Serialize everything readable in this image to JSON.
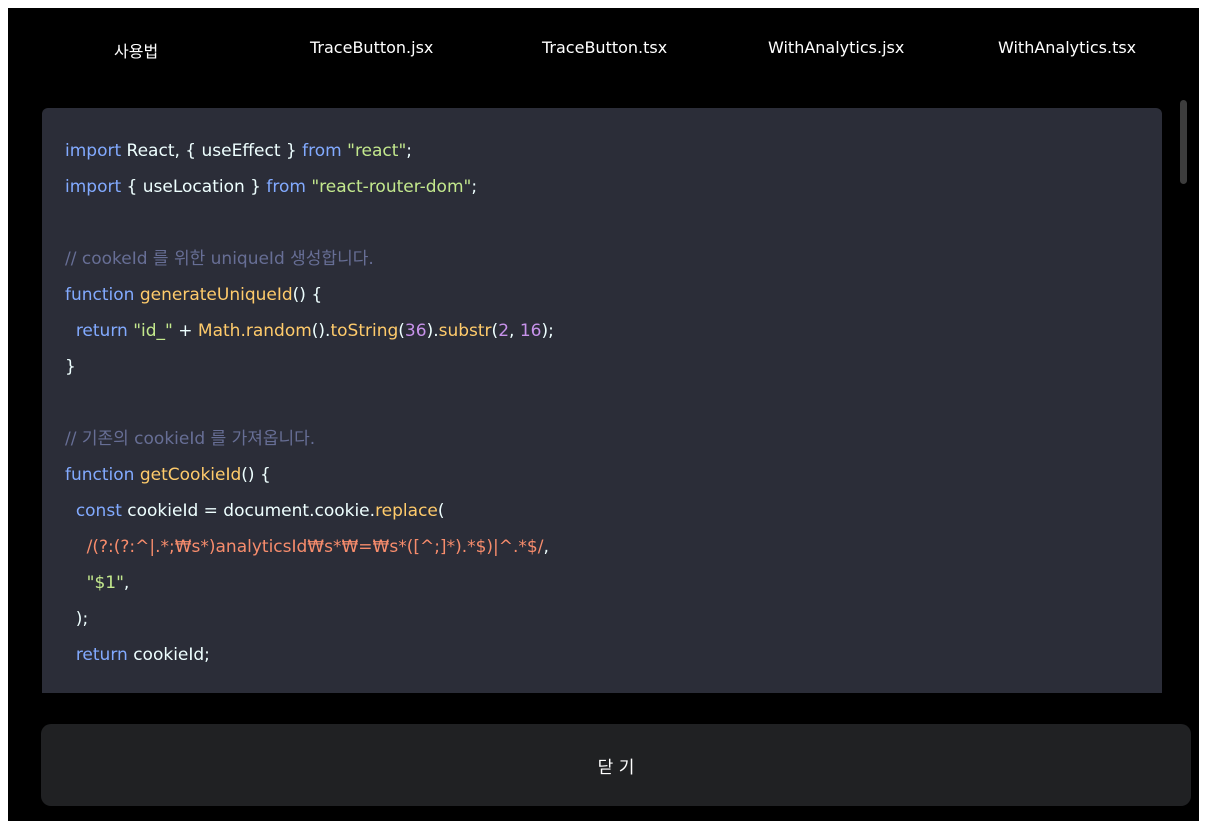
{
  "tabs": [
    {
      "label": "사용법"
    },
    {
      "label": "TraceButton.jsx"
    },
    {
      "label": "TraceButton.tsx"
    },
    {
      "label": "WithAnalytics.jsx"
    },
    {
      "label": "WithAnalytics.tsx"
    }
  ],
  "code": {
    "lines": [
      [
        {
          "t": "import",
          "c": "keyword"
        },
        {
          "t": " React, { useEffect } ",
          "c": "plain"
        },
        {
          "t": "from",
          "c": "keyword"
        },
        {
          "t": " ",
          "c": "plain"
        },
        {
          "t": "\"react\"",
          "c": "string"
        },
        {
          "t": ";",
          "c": "plain"
        }
      ],
      [
        {
          "t": "import",
          "c": "keyword"
        },
        {
          "t": " { useLocation } ",
          "c": "plain"
        },
        {
          "t": "from",
          "c": "keyword"
        },
        {
          "t": " ",
          "c": "plain"
        },
        {
          "t": "\"react-router-dom\"",
          "c": "string"
        },
        {
          "t": ";",
          "c": "plain"
        }
      ],
      [],
      [
        {
          "t": "// cookeId 를 위한 uniqueId 생성합니다.",
          "c": "comment"
        }
      ],
      [
        {
          "t": "function",
          "c": "keyword"
        },
        {
          "t": " ",
          "c": "plain"
        },
        {
          "t": "generateUniqueId",
          "c": "function"
        },
        {
          "t": "() {",
          "c": "plain"
        }
      ],
      [
        {
          "t": "  ",
          "c": "plain"
        },
        {
          "t": "return",
          "c": "keyword"
        },
        {
          "t": " ",
          "c": "plain"
        },
        {
          "t": "\"id_\"",
          "c": "string"
        },
        {
          "t": " + ",
          "c": "plain"
        },
        {
          "t": "Math.random",
          "c": "function"
        },
        {
          "t": "().",
          "c": "plain"
        },
        {
          "t": "toString",
          "c": "function"
        },
        {
          "t": "(",
          "c": "plain"
        },
        {
          "t": "36",
          "c": "number"
        },
        {
          "t": ").",
          "c": "plain"
        },
        {
          "t": "substr",
          "c": "function"
        },
        {
          "t": "(",
          "c": "plain"
        },
        {
          "t": "2",
          "c": "number"
        },
        {
          "t": ", ",
          "c": "plain"
        },
        {
          "t": "16",
          "c": "number"
        },
        {
          "t": ");",
          "c": "plain"
        }
      ],
      [
        {
          "t": "}",
          "c": "plain"
        }
      ],
      [],
      [
        {
          "t": "// 기존의 cookieId 를 가져옵니다.",
          "c": "comment"
        }
      ],
      [
        {
          "t": "function",
          "c": "keyword"
        },
        {
          "t": " ",
          "c": "plain"
        },
        {
          "t": "getCookieId",
          "c": "function"
        },
        {
          "t": "() {",
          "c": "plain"
        }
      ],
      [
        {
          "t": "  ",
          "c": "plain"
        },
        {
          "t": "const",
          "c": "keyword"
        },
        {
          "t": " cookieId = document.cookie.",
          "c": "plain"
        },
        {
          "t": "replace",
          "c": "function"
        },
        {
          "t": "(",
          "c": "plain"
        }
      ],
      [
        {
          "t": "    ",
          "c": "plain"
        },
        {
          "t": "/(?:(?:^|.*;₩s*)analyticsId₩s*₩=₩s*([^;]*).*$)|^.*$/",
          "c": "regex"
        },
        {
          "t": ",",
          "c": "plain"
        }
      ],
      [
        {
          "t": "    ",
          "c": "plain"
        },
        {
          "t": "\"$1\"",
          "c": "string"
        },
        {
          "t": ",",
          "c": "plain"
        }
      ],
      [
        {
          "t": "  );",
          "c": "plain"
        }
      ],
      [
        {
          "t": "  ",
          "c": "plain"
        },
        {
          "t": "return",
          "c": "keyword"
        },
        {
          "t": " cookieId;",
          "c": "plain"
        }
      ]
    ]
  },
  "footer": {
    "close_label": "닫 기"
  }
}
